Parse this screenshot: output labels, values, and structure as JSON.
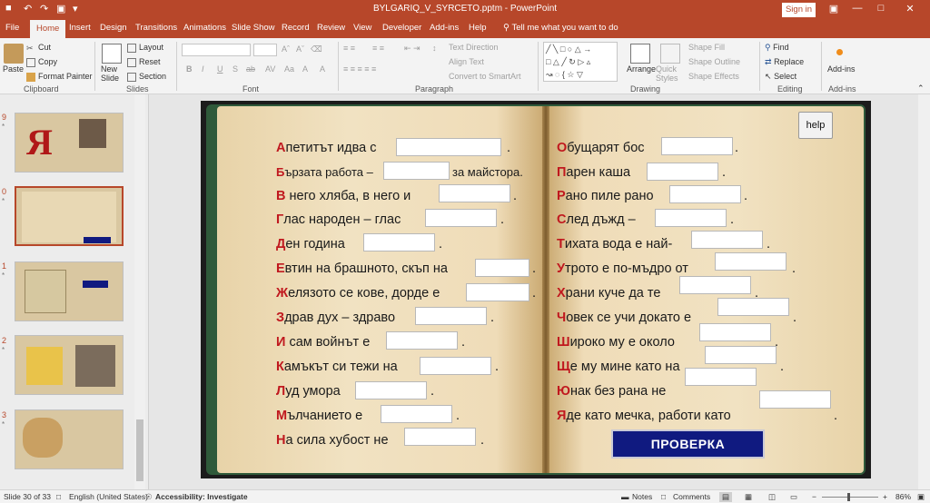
{
  "app": {
    "title": "BYLGARIQ_V_SYRCETO.pptm  -  PowerPoint",
    "sign_in": "Sign in"
  },
  "tabs": [
    "File",
    "Home",
    "Insert",
    "Design",
    "Transitions",
    "Animations",
    "Slide Show",
    "Record",
    "Review",
    "View",
    "Developer",
    "Add-ins",
    "Help"
  ],
  "tell_me": "Tell me what you want to do",
  "ribbon": {
    "clipboard": {
      "paste": "Paste",
      "cut": "Cut",
      "copy": "Copy",
      "format_painter": "Format Painter",
      "label": "Clipboard"
    },
    "slides": {
      "new_slide": "New Slide",
      "layout": "Layout",
      "reset": "Reset",
      "section": "Section",
      "label": "Slides"
    },
    "font": {
      "label": "Font",
      "buttons": [
        "B",
        "I",
        "U",
        "S",
        "ab",
        "AV",
        "Aa",
        "A",
        "A"
      ]
    },
    "paragraph": {
      "label": "Paragraph",
      "text_direction": "Text Direction",
      "align_text": "Align Text",
      "smartart": "Convert to SmartArt"
    },
    "drawing": {
      "label": "Drawing",
      "arrange": "Arrange",
      "quick_styles": "Quick Styles",
      "shape_fill": "Shape Fill",
      "shape_outline": "Shape Outline",
      "shape_effects": "Shape Effects"
    },
    "editing": {
      "label": "Editing",
      "find": "Find",
      "replace": "Replace",
      "select": "Select"
    },
    "addins": {
      "label": "Add-ins",
      "addins": "Add-ins"
    }
  },
  "thumbnails": [
    {
      "num": "9",
      "star": "*"
    },
    {
      "num": "0",
      "star": "*"
    },
    {
      "num": "1",
      "star": "*"
    },
    {
      "num": "2",
      "star": "*"
    },
    {
      "num": "3",
      "star": "*"
    }
  ],
  "slide": {
    "help": "help",
    "check": "ПРОВЕРКА",
    "left": [
      {
        "first": "А",
        "rest": "петитът идва с",
        "tail": "."
      },
      {
        "first": "Б",
        "rest": "ързата работа –",
        "tail": "за майстора."
      },
      {
        "first": "В",
        "rest": " него хляба, в него и",
        "tail": "."
      },
      {
        "first": "Г",
        "rest": "лас народен – глас",
        "tail": "."
      },
      {
        "first": "Д",
        "rest": "ен година",
        "tail": "."
      },
      {
        "first": "Е",
        "rest": "втин на брашното, скъп на",
        "tail": "."
      },
      {
        "first": "Ж",
        "rest": "елязото се кове, дорде е",
        "tail": "."
      },
      {
        "first": "З",
        "rest": "драв дух – здраво",
        "tail": "."
      },
      {
        "first": "И",
        "rest": " сам войнът е",
        "tail": "."
      },
      {
        "first": "К",
        "rest": "амъкът си тежи на",
        "tail": "."
      },
      {
        "first": "Л",
        "rest": "уд умора",
        "tail": "."
      },
      {
        "first": "М",
        "rest": "ълчанието е",
        "tail": "."
      },
      {
        "first": "Н",
        "rest": "а сила хубост не",
        "tail": "."
      }
    ],
    "right": [
      {
        "first": "О",
        "rest": "бущарят бос",
        "tail": "."
      },
      {
        "first": "П",
        "rest": "арен каша",
        "tail": "."
      },
      {
        "first": "Р",
        "rest": "ано пиле рано",
        "tail": "."
      },
      {
        "first": "С",
        "rest": "лед дъжд –",
        "tail": "."
      },
      {
        "first": "Т",
        "rest": "ихата вода е най-",
        "tail": "."
      },
      {
        "first": "У",
        "rest": "трото е по-мъдро от",
        "tail": "."
      },
      {
        "first": "Х",
        "rest": "рани куче да те",
        "tail": "."
      },
      {
        "first": "Ч",
        "rest": "овек се учи докато е",
        "tail": "."
      },
      {
        "first": "Ш",
        "rest": "ироко му е около",
        "tail": "."
      },
      {
        "first": "Щ",
        "rest": "е му мине като на",
        "tail": "."
      },
      {
        "first": "Ю",
        "rest": "нак без рана не",
        "tail": "."
      },
      {
        "first": "Я",
        "rest": "де като мечка, работи като",
        "tail": "."
      }
    ]
  },
  "status": {
    "slide_of": "Slide 30 of 33",
    "language": "English (United States)",
    "accessibility": "Accessibility: Investigate",
    "notes": "Notes",
    "comments": "Comments",
    "zoom": "86%"
  },
  "colors": {
    "accent": "#b7472a",
    "letter": "#c0181e",
    "check_button": "#101a80"
  }
}
